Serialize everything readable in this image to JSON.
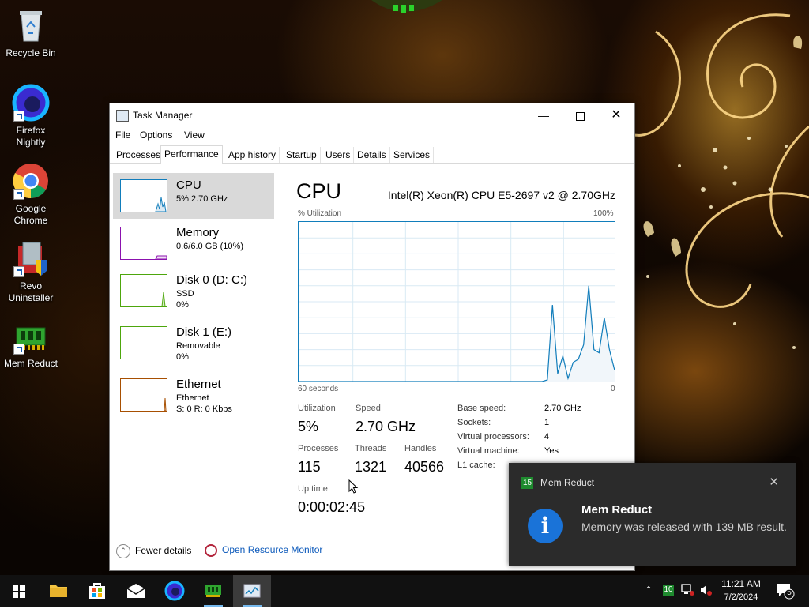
{
  "desktop": {
    "icons": [
      {
        "label": "Recycle Bin"
      },
      {
        "label": "Firefox Nightly"
      },
      {
        "label": "Google Chrome"
      },
      {
        "label": "Revo Uninstaller"
      },
      {
        "label": "Mem Reduct"
      }
    ]
  },
  "task_manager": {
    "title": "Task Manager",
    "menu": [
      "File",
      "Options",
      "View"
    ],
    "tabs": [
      "Processes",
      "Performance",
      "App history",
      "Startup",
      "Users",
      "Details",
      "Services"
    ],
    "active_tab": "Performance",
    "sidebar": [
      {
        "name": "CPU",
        "line1": "5%  2.70 GHz",
        "line2": "",
        "color": "#117dbb"
      },
      {
        "name": "Memory",
        "line1": "0.6/6.0 GB (10%)",
        "line2": "",
        "color": "#8b12ae"
      },
      {
        "name": "Disk 0 (D: C:)",
        "line1": "SSD",
        "line2": "0%",
        "color": "#4da60c"
      },
      {
        "name": "Disk 1 (E:)",
        "line1": "Removable",
        "line2": "0%",
        "color": "#4da60c"
      },
      {
        "name": "Ethernet",
        "line1": "Ethernet",
        "line2": "S: 0  R: 0 Kbps",
        "color": "#a74f01"
      }
    ],
    "cpu": {
      "heading": "CPU",
      "model": "Intel(R) Xeon(R) CPU E5-2697 v2 @ 2.70GHz",
      "graph_ylabel": "% Utilization",
      "graph_ymax": "100%",
      "graph_xlabel": "60 seconds",
      "graph_xmin": "0",
      "utilization_series": [
        0,
        0,
        0,
        0,
        0,
        0,
        0,
        0,
        0,
        0,
        0,
        0,
        0,
        0,
        0,
        0,
        0,
        0,
        0,
        0,
        0,
        0,
        0,
        0,
        0,
        0,
        0,
        0,
        0,
        0,
        0,
        0,
        0,
        0,
        0,
        0,
        0,
        0,
        0,
        0,
        0,
        0,
        0,
        0,
        0,
        0,
        0,
        0,
        1,
        48,
        5,
        16,
        2,
        12,
        14,
        23,
        60,
        20,
        18,
        40,
        20,
        7
      ],
      "stats": {
        "utilization_label": "Utilization",
        "utilization": "5%",
        "speed_label": "Speed",
        "speed": "2.70 GHz",
        "processes_label": "Processes",
        "processes": "115",
        "threads_label": "Threads",
        "threads": "1321",
        "handles_label": "Handles",
        "handles": "40566",
        "uptime_label": "Up time",
        "uptime": "0:00:02:45"
      },
      "details": [
        {
          "k": "Base speed:",
          "v": "2.70 GHz"
        },
        {
          "k": "Sockets:",
          "v": "1"
        },
        {
          "k": "Virtual processors:",
          "v": "4"
        },
        {
          "k": "Virtual machine:",
          "v": "Yes"
        },
        {
          "k": "L1 cache:",
          "v": ""
        }
      ]
    },
    "footer": {
      "fewer": "Fewer details",
      "resmon": "Open Resource Monitor"
    }
  },
  "toast": {
    "badge": "15",
    "app": "Mem Reduct",
    "heading": "Mem Reduct",
    "body": "Memory was released with 139 MB result."
  },
  "taskbar": {
    "tray_badge": "10",
    "time": "11:21 AM",
    "date": "7/2/2024",
    "notifications": "5"
  }
}
